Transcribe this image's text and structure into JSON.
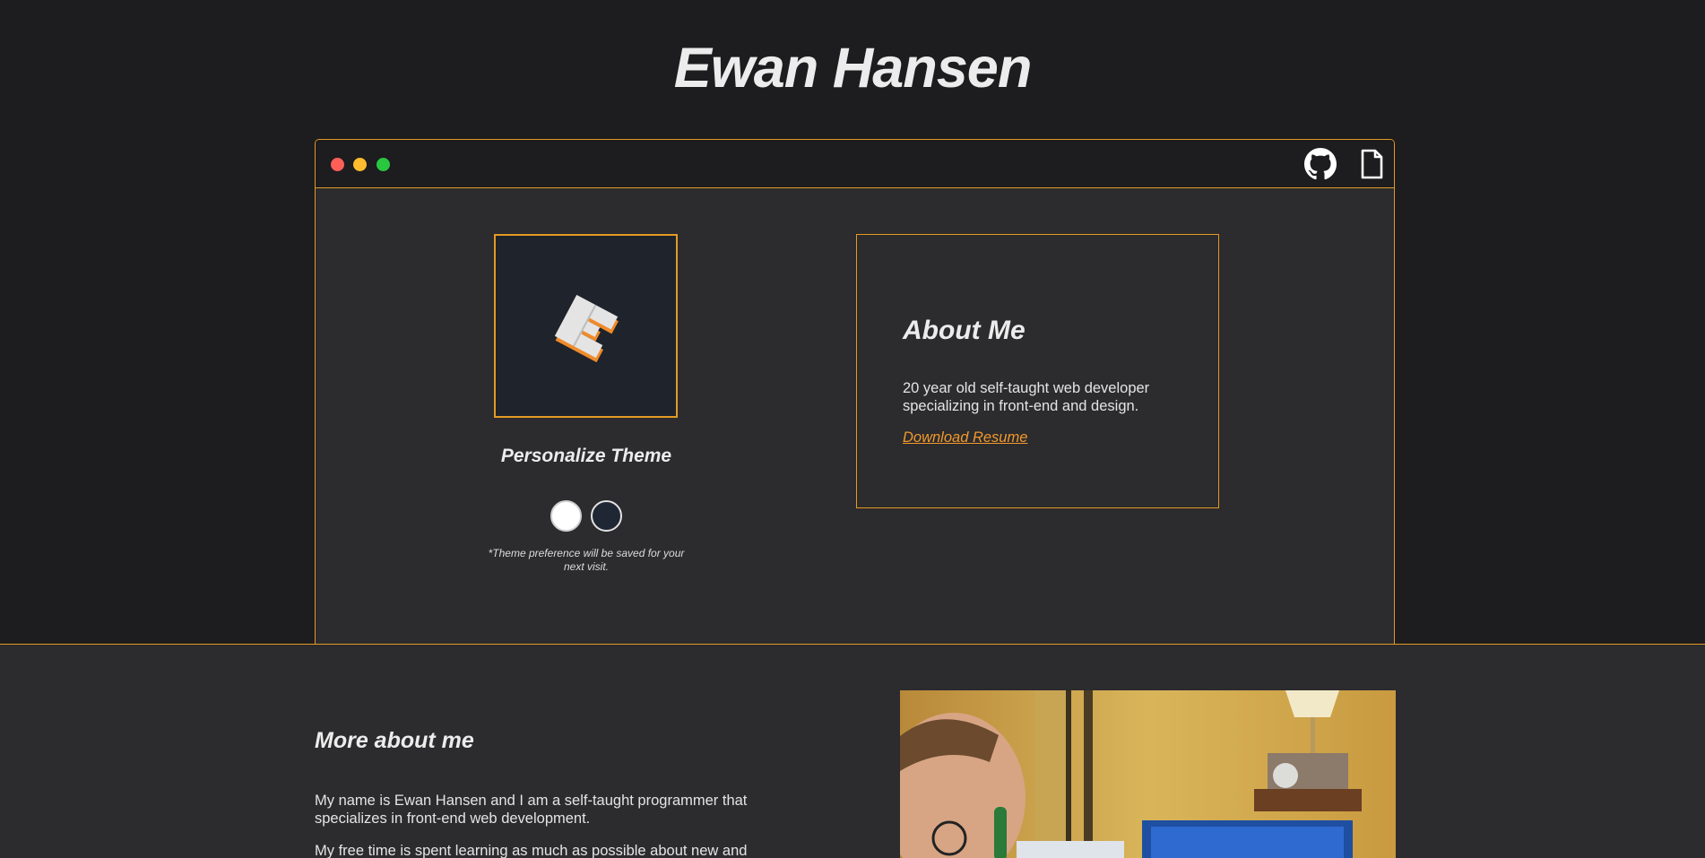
{
  "header": {
    "title": "Ewan Hansen"
  },
  "window": {
    "controls": [
      "close",
      "minimize",
      "maximize"
    ],
    "icons": [
      "github-icon",
      "document-icon"
    ]
  },
  "theme": {
    "heading": "Personalize Theme",
    "note": "*Theme preference will be saved for your next visit.",
    "swatches": [
      "#ffffff",
      "#1f2734"
    ]
  },
  "about": {
    "heading": "About Me",
    "text": "20 year old self-taught web developer specializing in front-end and design.",
    "link_label": "Download Resume"
  },
  "more": {
    "heading": "More about me",
    "p1": "My name is Ewan Hansen and I am a self-taught programmer that specializes in front-end web development.",
    "p2": "My free time is spent learning as much as possible about new and"
  },
  "colors": {
    "accent": "#e39a22",
    "link": "#f0992b",
    "background": "#1d1c1e",
    "panel": "#2c2b2e"
  }
}
